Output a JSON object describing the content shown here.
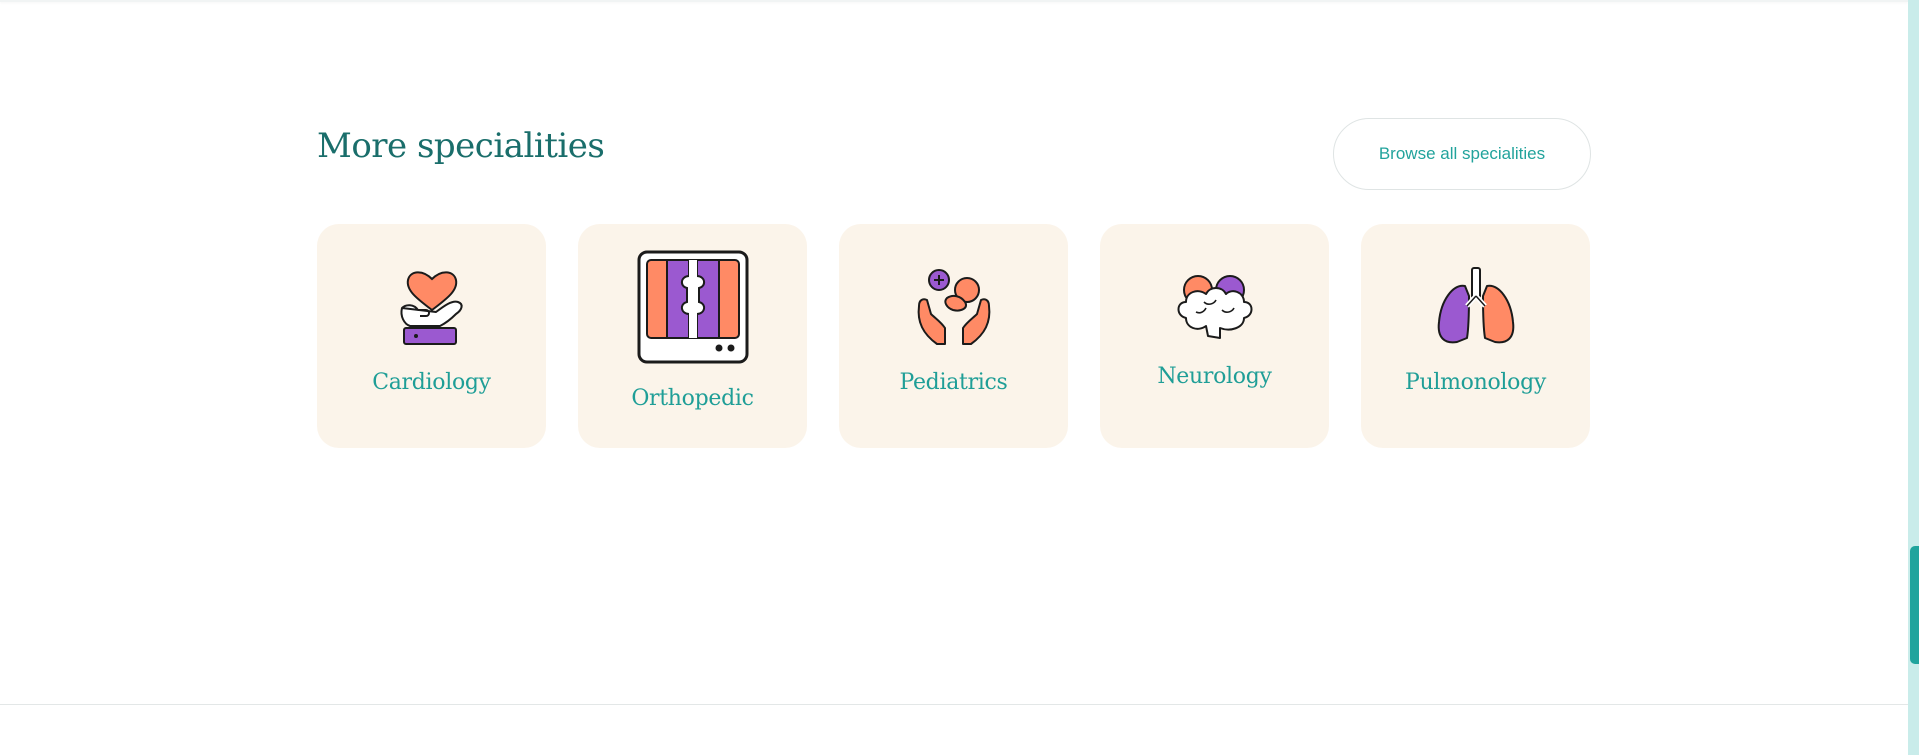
{
  "section": {
    "title": "More specialities",
    "browse_label": "Browse all specialities"
  },
  "cards": [
    {
      "label": "Cardiology",
      "icon": "heart-hand-icon"
    },
    {
      "label": "Orthopedic",
      "icon": "xray-bone-icon"
    },
    {
      "label": "Pediatrics",
      "icon": "baby-hands-icon"
    },
    {
      "label": "Neurology",
      "icon": "brain-icon"
    },
    {
      "label": "Pulmonology",
      "icon": "lungs-icon"
    }
  ],
  "colors": {
    "accent": "#22a39c",
    "title": "#1a6e6b",
    "card_bg": "#fbf4ea",
    "orange": "#ff8a65",
    "purple": "#9b59d0"
  }
}
